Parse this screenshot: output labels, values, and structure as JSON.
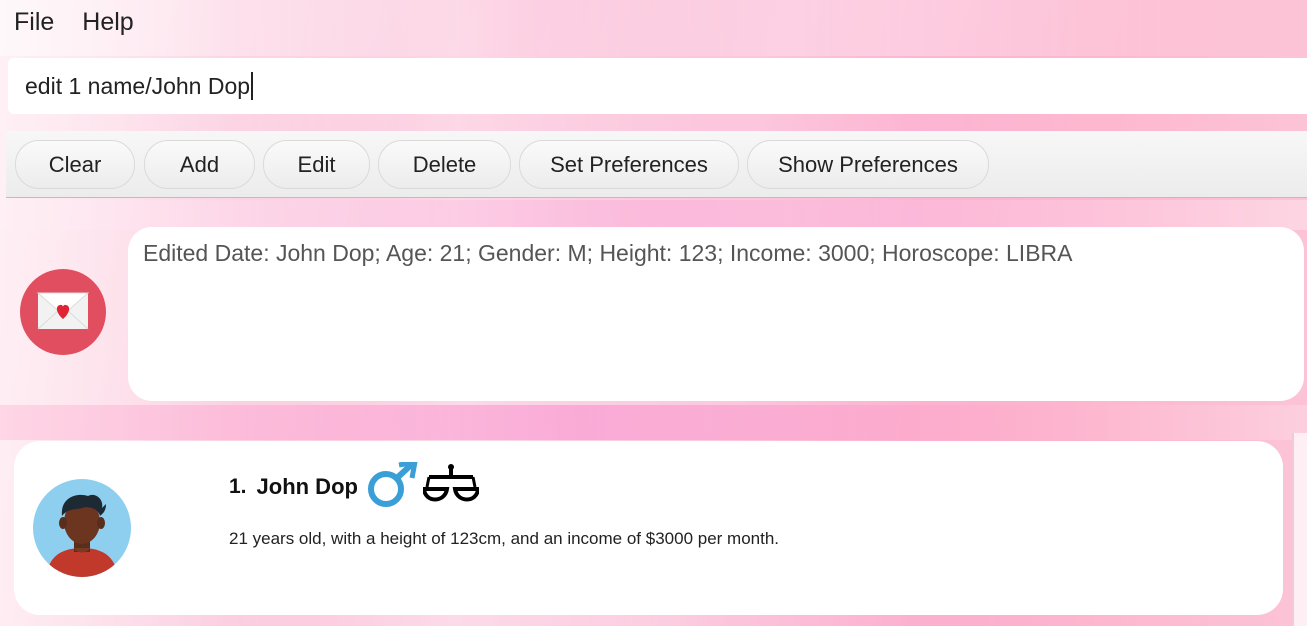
{
  "menu": {
    "items": [
      "File",
      "Help"
    ]
  },
  "command_box": {
    "value": "edit 1 name/John Dop"
  },
  "toolbar": {
    "buttons": [
      "Clear",
      "Add",
      "Edit",
      "Delete",
      "Set Preferences",
      "Show Preferences"
    ]
  },
  "result": {
    "icon": "envelope-heart-icon",
    "text": "Edited Date: John Dop; Age: 21; Gender: M; Height: 123; Income: 3000; Horoscope: LIBRA"
  },
  "persons": [
    {
      "index": "1.",
      "name": "John Dop",
      "gender_icon": "male-symbol-icon",
      "horoscope_icon": "libra-icon",
      "description": "21 years old, with a height of 123cm, and an income of $3000 per month."
    }
  ],
  "colors": {
    "result_icon_bg": "#e04e5f",
    "gender_icon": "#3a9fd6",
    "avatar_bg": "#8ecff0",
    "shirt": "#c0392b"
  }
}
